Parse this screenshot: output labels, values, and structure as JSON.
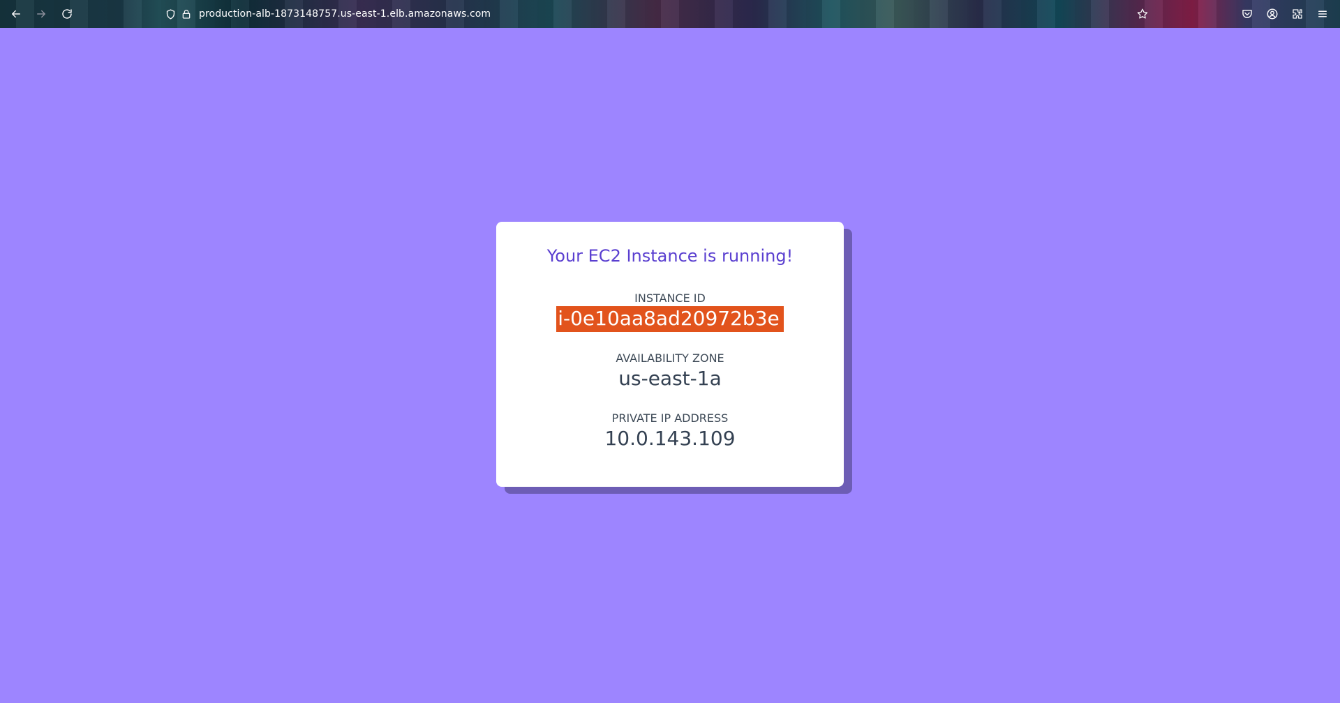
{
  "browser": {
    "url": "production-alb-1873148757.us-east-1.elb.amazonaws.com",
    "icons": [
      "back-icon",
      "forward-icon",
      "reload-icon",
      "shield-icon",
      "lock-icon",
      "bookmark-star-icon",
      "pocket-icon",
      "account-icon",
      "extensions-icon",
      "menu-icon"
    ]
  },
  "card": {
    "title": "Your EC2 Instance is running!",
    "fields": [
      {
        "label": "INSTANCE ID",
        "value": "i-0e10aa8ad20972b3e",
        "selected": true
      },
      {
        "label": "AVAILABILITY ZONE",
        "value": "us-east-1a"
      },
      {
        "label": "PRIVATE IP ADDRESS",
        "value": "10.0.143.109"
      }
    ]
  },
  "colors": {
    "page_background": "#9d85ff",
    "title": "#5a3fd0",
    "selection": "#e2531c"
  }
}
